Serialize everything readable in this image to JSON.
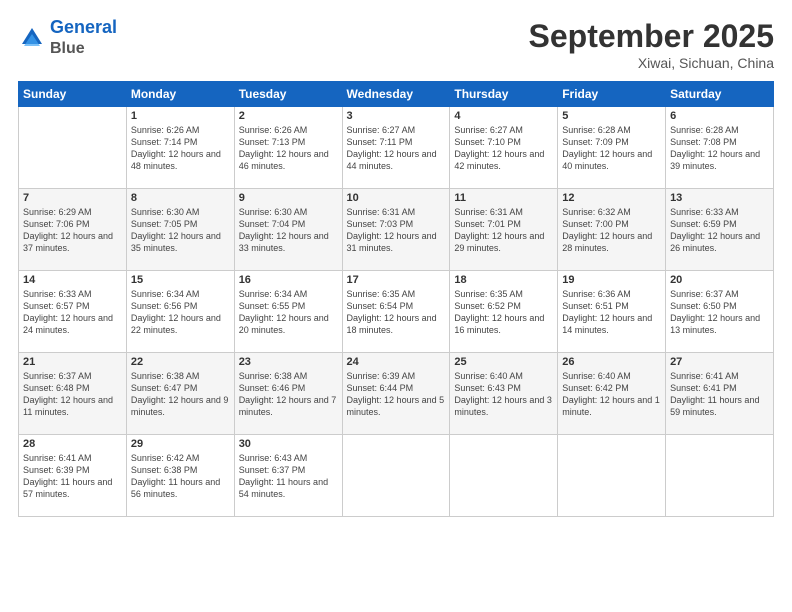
{
  "logo": {
    "line1": "General",
    "line2": "Blue"
  },
  "title": "September 2025",
  "subtitle": "Xiwai, Sichuan, China",
  "days_header": [
    "Sunday",
    "Monday",
    "Tuesday",
    "Wednesday",
    "Thursday",
    "Friday",
    "Saturday"
  ],
  "weeks": [
    [
      {
        "day": "",
        "info": ""
      },
      {
        "day": "1",
        "info": "Sunrise: 6:26 AM\nSunset: 7:14 PM\nDaylight: 12 hours\nand 48 minutes."
      },
      {
        "day": "2",
        "info": "Sunrise: 6:26 AM\nSunset: 7:13 PM\nDaylight: 12 hours\nand 46 minutes."
      },
      {
        "day": "3",
        "info": "Sunrise: 6:27 AM\nSunset: 7:11 PM\nDaylight: 12 hours\nand 44 minutes."
      },
      {
        "day": "4",
        "info": "Sunrise: 6:27 AM\nSunset: 7:10 PM\nDaylight: 12 hours\nand 42 minutes."
      },
      {
        "day": "5",
        "info": "Sunrise: 6:28 AM\nSunset: 7:09 PM\nDaylight: 12 hours\nand 40 minutes."
      },
      {
        "day": "6",
        "info": "Sunrise: 6:28 AM\nSunset: 7:08 PM\nDaylight: 12 hours\nand 39 minutes."
      }
    ],
    [
      {
        "day": "7",
        "info": "Sunrise: 6:29 AM\nSunset: 7:06 PM\nDaylight: 12 hours\nand 37 minutes."
      },
      {
        "day": "8",
        "info": "Sunrise: 6:30 AM\nSunset: 7:05 PM\nDaylight: 12 hours\nand 35 minutes."
      },
      {
        "day": "9",
        "info": "Sunrise: 6:30 AM\nSunset: 7:04 PM\nDaylight: 12 hours\nand 33 minutes."
      },
      {
        "day": "10",
        "info": "Sunrise: 6:31 AM\nSunset: 7:03 PM\nDaylight: 12 hours\nand 31 minutes."
      },
      {
        "day": "11",
        "info": "Sunrise: 6:31 AM\nSunset: 7:01 PM\nDaylight: 12 hours\nand 29 minutes."
      },
      {
        "day": "12",
        "info": "Sunrise: 6:32 AM\nSunset: 7:00 PM\nDaylight: 12 hours\nand 28 minutes."
      },
      {
        "day": "13",
        "info": "Sunrise: 6:33 AM\nSunset: 6:59 PM\nDaylight: 12 hours\nand 26 minutes."
      }
    ],
    [
      {
        "day": "14",
        "info": "Sunrise: 6:33 AM\nSunset: 6:57 PM\nDaylight: 12 hours\nand 24 minutes."
      },
      {
        "day": "15",
        "info": "Sunrise: 6:34 AM\nSunset: 6:56 PM\nDaylight: 12 hours\nand 22 minutes."
      },
      {
        "day": "16",
        "info": "Sunrise: 6:34 AM\nSunset: 6:55 PM\nDaylight: 12 hours\nand 20 minutes."
      },
      {
        "day": "17",
        "info": "Sunrise: 6:35 AM\nSunset: 6:54 PM\nDaylight: 12 hours\nand 18 minutes."
      },
      {
        "day": "18",
        "info": "Sunrise: 6:35 AM\nSunset: 6:52 PM\nDaylight: 12 hours\nand 16 minutes."
      },
      {
        "day": "19",
        "info": "Sunrise: 6:36 AM\nSunset: 6:51 PM\nDaylight: 12 hours\nand 14 minutes."
      },
      {
        "day": "20",
        "info": "Sunrise: 6:37 AM\nSunset: 6:50 PM\nDaylight: 12 hours\nand 13 minutes."
      }
    ],
    [
      {
        "day": "21",
        "info": "Sunrise: 6:37 AM\nSunset: 6:48 PM\nDaylight: 12 hours\nand 11 minutes."
      },
      {
        "day": "22",
        "info": "Sunrise: 6:38 AM\nSunset: 6:47 PM\nDaylight: 12 hours\nand 9 minutes."
      },
      {
        "day": "23",
        "info": "Sunrise: 6:38 AM\nSunset: 6:46 PM\nDaylight: 12 hours\nand 7 minutes."
      },
      {
        "day": "24",
        "info": "Sunrise: 6:39 AM\nSunset: 6:44 PM\nDaylight: 12 hours\nand 5 minutes."
      },
      {
        "day": "25",
        "info": "Sunrise: 6:40 AM\nSunset: 6:43 PM\nDaylight: 12 hours\nand 3 minutes."
      },
      {
        "day": "26",
        "info": "Sunrise: 6:40 AM\nSunset: 6:42 PM\nDaylight: 12 hours\nand 1 minute."
      },
      {
        "day": "27",
        "info": "Sunrise: 6:41 AM\nSunset: 6:41 PM\nDaylight: 11 hours\nand 59 minutes."
      }
    ],
    [
      {
        "day": "28",
        "info": "Sunrise: 6:41 AM\nSunset: 6:39 PM\nDaylight: 11 hours\nand 57 minutes."
      },
      {
        "day": "29",
        "info": "Sunrise: 6:42 AM\nSunset: 6:38 PM\nDaylight: 11 hours\nand 56 minutes."
      },
      {
        "day": "30",
        "info": "Sunrise: 6:43 AM\nSunset: 6:37 PM\nDaylight: 11 hours\nand 54 minutes."
      },
      {
        "day": "",
        "info": ""
      },
      {
        "day": "",
        "info": ""
      },
      {
        "day": "",
        "info": ""
      },
      {
        "day": "",
        "info": ""
      }
    ]
  ]
}
